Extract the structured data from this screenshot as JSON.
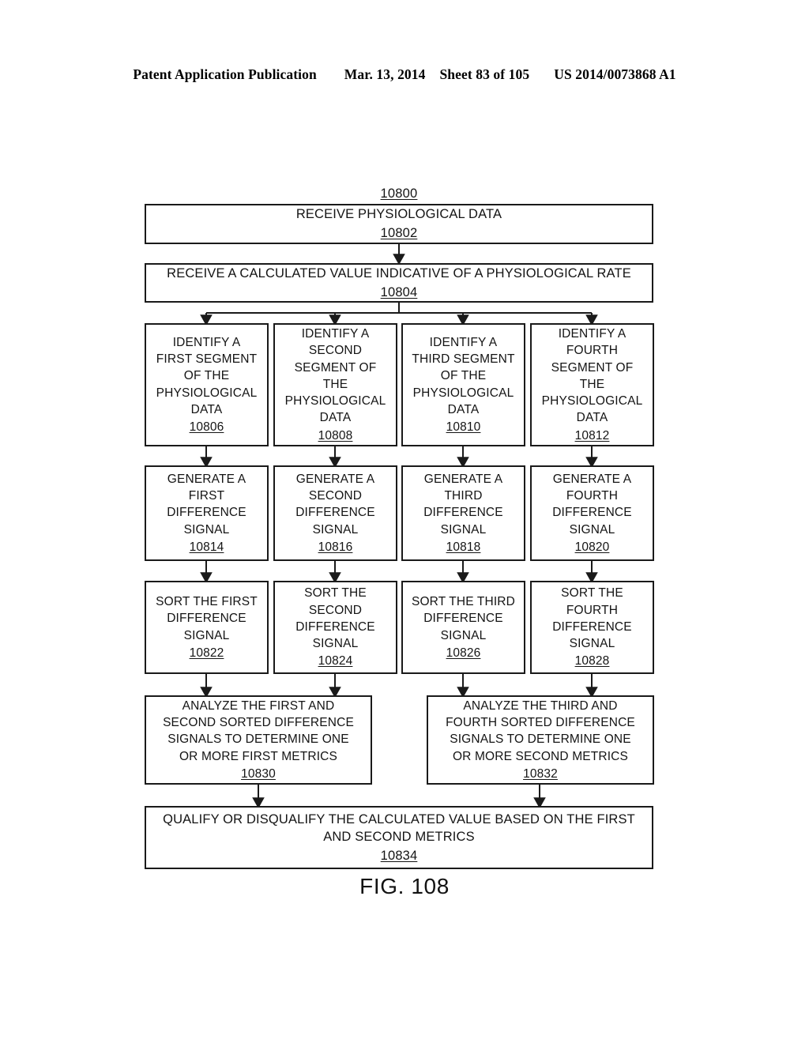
{
  "header": {
    "left": "Patent Application Publication",
    "date": "Mar. 13, 2014",
    "sheet": "Sheet 83 of 105",
    "patent_number": "US 2014/0073868 A1"
  },
  "figure": {
    "caption": "FIG. 108",
    "overall_ref": "10800"
  },
  "nodes": {
    "receive_data": {
      "text": "RECEIVE PHYSIOLOGICAL DATA",
      "ref": "10802"
    },
    "receive_value": {
      "text": "RECEIVE A CALCULATED VALUE INDICATIVE OF A PHYSIOLOGICAL RATE",
      "ref": "10804"
    },
    "identify_1": {
      "text": "IDENTIFY A\nFIRST SEGMENT\nOF THE\nPHYSIOLOGICAL\nDATA",
      "ref": "10806"
    },
    "identify_2": {
      "text": "IDENTIFY A\nSECOND\nSEGMENT OF\nTHE\nPHYSIOLOGICAL\nDATA",
      "ref": "10808"
    },
    "identify_3": {
      "text": "IDENTIFY A\nTHIRD SEGMENT\nOF THE\nPHYSIOLOGICAL\nDATA",
      "ref": "10810"
    },
    "identify_4": {
      "text": "IDENTIFY A\nFOURTH\nSEGMENT OF\nTHE\nPHYSIOLOGICAL\nDATA",
      "ref": "10812"
    },
    "generate_1": {
      "text": "GENERATE A\nFIRST\nDIFFERENCE\nSIGNAL",
      "ref": "10814"
    },
    "generate_2": {
      "text": "GENERATE A\nSECOND\nDIFFERENCE\nSIGNAL",
      "ref": "10816"
    },
    "generate_3": {
      "text": "GENERATE A\nTHIRD\nDIFFERENCE\nSIGNAL",
      "ref": "10818"
    },
    "generate_4": {
      "text": "GENERATE A\nFOURTH\nDIFFERENCE\nSIGNAL",
      "ref": "10820"
    },
    "sort_1": {
      "text": "SORT THE FIRST\nDIFFERENCE\nSIGNAL",
      "ref": "10822"
    },
    "sort_2": {
      "text": "SORT THE\nSECOND\nDIFFERENCE\nSIGNAL",
      "ref": "10824"
    },
    "sort_3": {
      "text": "SORT THE THIRD\nDIFFERENCE\nSIGNAL",
      "ref": "10826"
    },
    "sort_4": {
      "text": "SORT THE\nFOURTH\nDIFFERENCE\nSIGNAL",
      "ref": "10828"
    },
    "analyze_1": {
      "text": "ANALYZE THE FIRST AND\nSECOND SORTED DIFFERENCE\nSIGNALS TO DETERMINE ONE\nOR MORE FIRST METRICS",
      "ref": "10830"
    },
    "analyze_2": {
      "text": "ANALYZE THE THIRD AND\nFOURTH SORTED DIFFERENCE\nSIGNALS TO DETERMINE ONE\nOR MORE SECOND METRICS",
      "ref": "10832"
    },
    "qualify": {
      "text": "QUALIFY OR DISQUALIFY THE CALCULATED VALUE BASED ON THE FIRST\nAND SECOND METRICS",
      "ref": "10834"
    }
  }
}
